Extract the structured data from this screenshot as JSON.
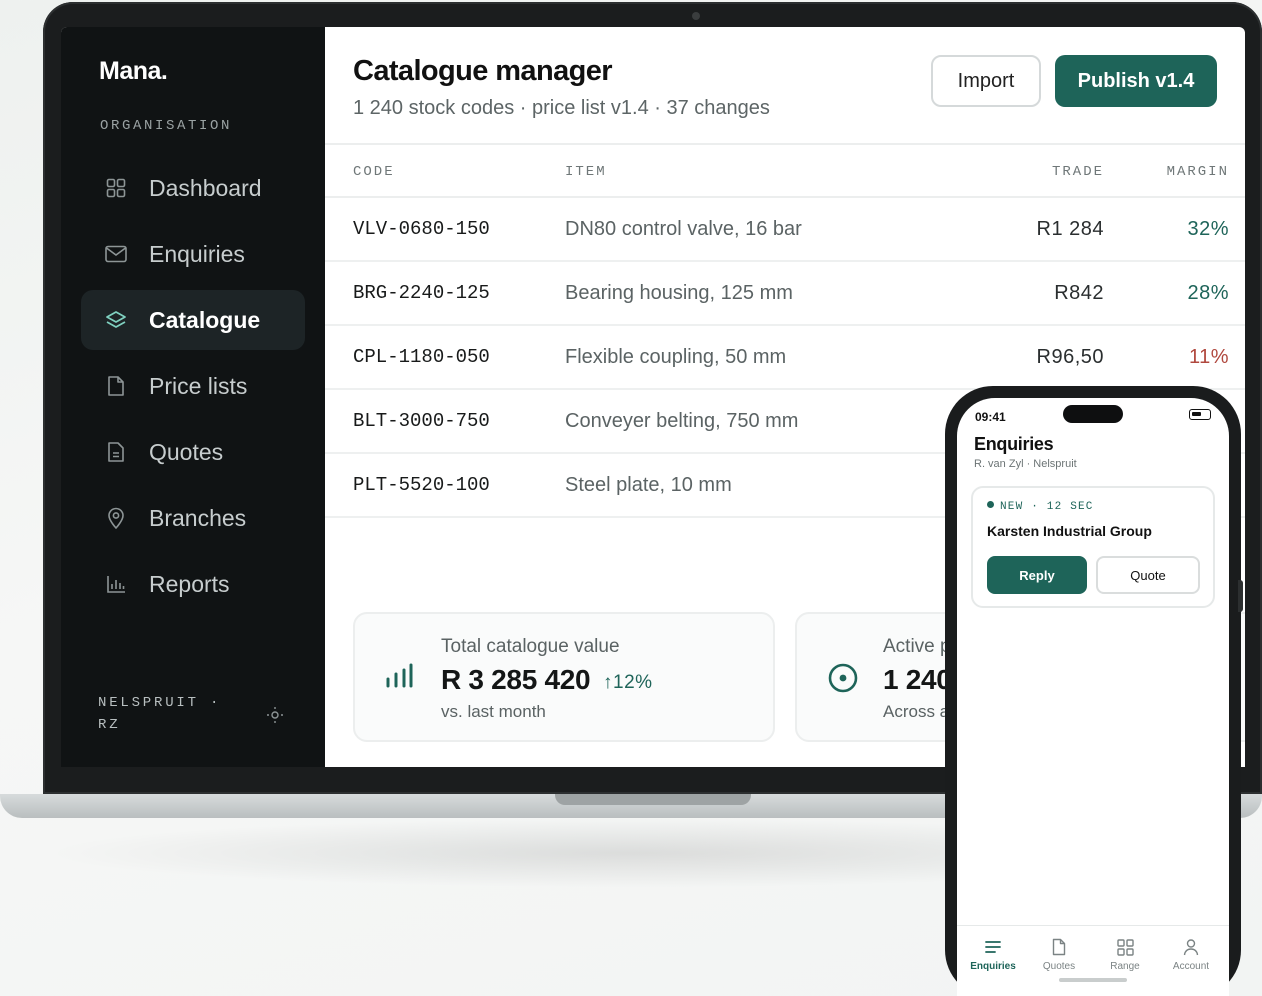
{
  "brand": "Mana.",
  "sidebar": {
    "section_label": "ORGANISATION",
    "items": [
      {
        "label": "Dashboard",
        "icon": "grid-icon",
        "active": false
      },
      {
        "label": "Enquiries",
        "icon": "mail-icon",
        "active": false
      },
      {
        "label": "Catalogue",
        "icon": "layers-icon",
        "active": true
      },
      {
        "label": "Price lists",
        "icon": "file-icon",
        "active": false
      },
      {
        "label": "Quotes",
        "icon": "document-icon",
        "active": false
      },
      {
        "label": "Branches",
        "icon": "map-pin-icon",
        "active": false
      },
      {
        "label": "Reports",
        "icon": "bar-chart-icon",
        "active": false
      }
    ],
    "footer_line1": "NELSPRUIT ·",
    "footer_line2": "RZ",
    "footer_icon": "sun-icon"
  },
  "header": {
    "title": "Catalogue manager",
    "subtitle": "1 240 stock codes · price list v1.4 · 37 changes",
    "import_label": "Import",
    "publish_label": "Publish v1.4"
  },
  "table": {
    "columns": [
      "CODE",
      "ITEM",
      "TRADE",
      "MARGIN"
    ],
    "rows": [
      {
        "code": "VLV-0680-150",
        "item": "DN80 control valve, 16 bar",
        "trade": "R1 284",
        "margin": "32%",
        "margin_status": "good"
      },
      {
        "code": "BRG-2240-125",
        "item": "Bearing housing, 125 mm",
        "trade": "R842",
        "margin": "28%",
        "margin_status": "good"
      },
      {
        "code": "CPL-1180-050",
        "item": "Flexible coupling, 50 mm",
        "trade": "R96,50",
        "margin": "11%",
        "margin_status": "low"
      },
      {
        "code": "BLT-3000-750",
        "item": "Conveyer belting, 750 mm",
        "trade": "",
        "margin": "",
        "margin_status": "good"
      },
      {
        "code": "PLT-5520-100",
        "item": "Steel plate, 10 mm",
        "trade": "",
        "margin": "",
        "margin_status": "good"
      }
    ]
  },
  "stats": [
    {
      "label": "Total catalogue value",
      "value": "R 3 285 420",
      "delta": "↑12%",
      "sub": "vs. last month",
      "icon": "signal-bars-icon"
    },
    {
      "label": "Active p",
      "value": "1 240",
      "delta": "",
      "sub": "Across a",
      "icon": "target-icon"
    }
  ],
  "phone": {
    "time": "09:41",
    "title": "Enquiries",
    "subtitle": "R. van Zyl · Nelspruit",
    "card": {
      "badge": "NEW · 12 SEC",
      "company": "Karsten Industrial Group",
      "reply_label": "Reply",
      "quote_label": "Quote"
    },
    "tabs": [
      {
        "label": "Enquiries",
        "icon": "list-icon",
        "active": true
      },
      {
        "label": "Quotes",
        "icon": "file-icon",
        "active": false
      },
      {
        "label": "Range",
        "icon": "grid-icon",
        "active": false
      },
      {
        "label": "Account",
        "icon": "user-icon",
        "active": false
      }
    ]
  },
  "colors": {
    "accent": "#1e6459",
    "sidebar_bg": "#101314",
    "margin_good": "#1e6459",
    "margin_low": "#b0483e"
  }
}
